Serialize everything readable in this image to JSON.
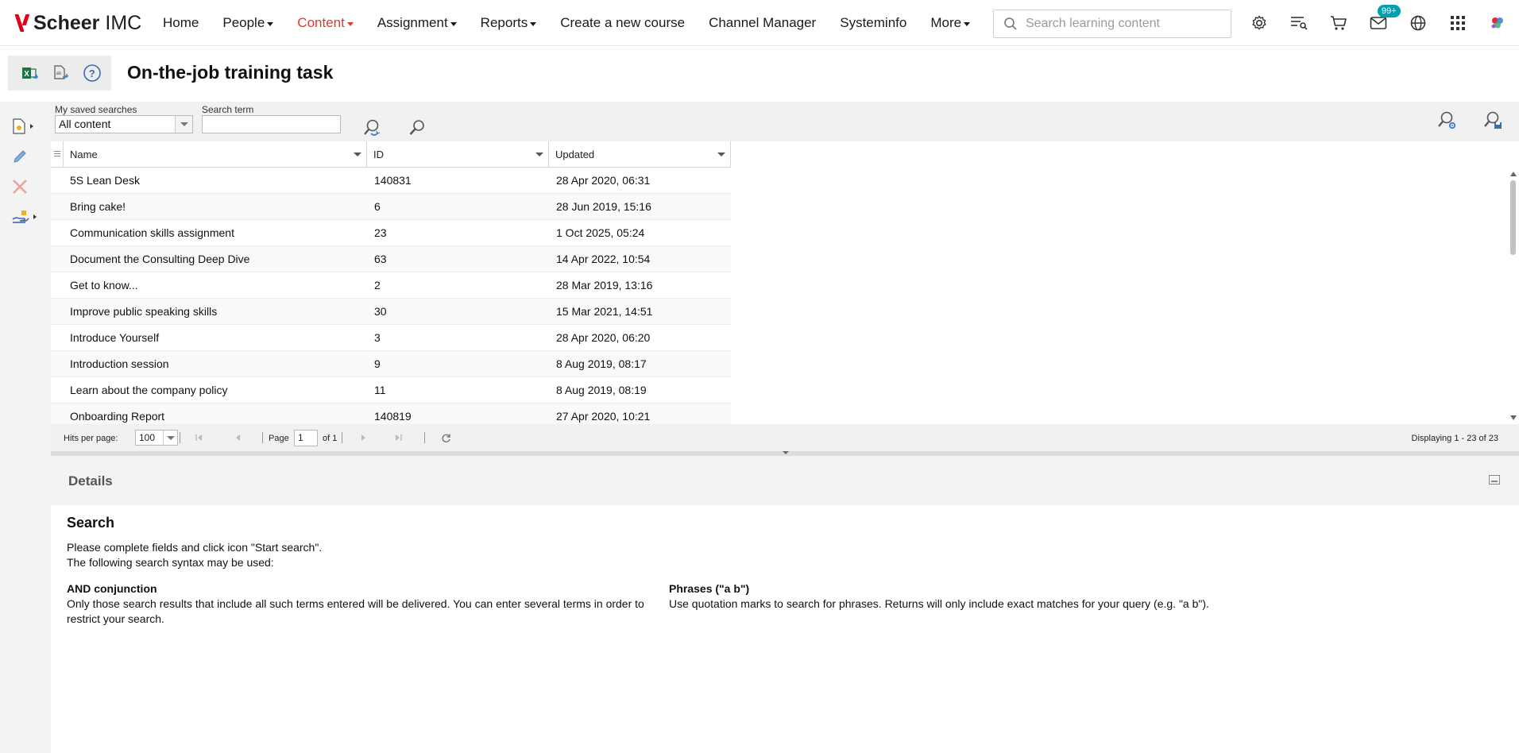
{
  "header": {
    "brand": "Scheer",
    "product": "IMC",
    "nav": [
      {
        "label": "Home",
        "dropdown": false,
        "active": false
      },
      {
        "label": "People",
        "dropdown": true,
        "active": false
      },
      {
        "label": "Content",
        "dropdown": true,
        "active": true
      },
      {
        "label": "Assignment",
        "dropdown": true,
        "active": false
      },
      {
        "label": "Reports",
        "dropdown": true,
        "active": false
      },
      {
        "label": "Create a new course",
        "dropdown": false,
        "active": false
      },
      {
        "label": "Channel Manager",
        "dropdown": false,
        "active": false
      },
      {
        "label": "Systeminfo",
        "dropdown": false,
        "active": false
      },
      {
        "label": "More",
        "dropdown": true,
        "active": false
      }
    ],
    "search_placeholder": "Search learning content",
    "mail_badge": "99+",
    "icons": [
      "gear-icon",
      "playlist-search-icon",
      "cart-icon",
      "mail-icon",
      "globe-icon",
      "apps-grid-icon",
      "colorful-logo-icon"
    ]
  },
  "page": {
    "title": "On-the-job training task"
  },
  "filter": {
    "saved_label": "My saved searches",
    "saved_value": "All content",
    "term_label": "Search term",
    "term_value": ""
  },
  "grid": {
    "columns": [
      "Name",
      "ID",
      "Updated"
    ],
    "rows": [
      {
        "name": "5S Lean Desk",
        "id": "140831",
        "updated": "28 Apr 2020, 06:31"
      },
      {
        "name": "Bring cake!",
        "id": "6",
        "updated": "28 Jun 2019, 15:16"
      },
      {
        "name": "Communication skills assignment",
        "id": "23",
        "updated": "1 Oct 2025, 05:24"
      },
      {
        "name": "Document the Consulting Deep Dive",
        "id": "63",
        "updated": "14 Apr 2022, 10:54"
      },
      {
        "name": "Get to know...",
        "id": "2",
        "updated": "28 Mar 2019, 13:16"
      },
      {
        "name": "Improve public speaking skills",
        "id": "30",
        "updated": "15 Mar 2021, 14:51"
      },
      {
        "name": "Introduce Yourself",
        "id": "3",
        "updated": "28 Apr 2020, 06:20"
      },
      {
        "name": "Introduction session",
        "id": "9",
        "updated": "8 Aug 2019, 08:17"
      },
      {
        "name": "Learn about the company policy",
        "id": "11",
        "updated": "8 Aug 2019, 08:19"
      },
      {
        "name": "Onboarding Report",
        "id": "140819",
        "updated": "27 Apr 2020, 10:21"
      }
    ]
  },
  "pager": {
    "hits_label": "Hits per page:",
    "hits_value": "100",
    "page_label": "Page",
    "page_value": "1",
    "of_label": "of 1",
    "display_text": "Displaying 1 - 23 of 23"
  },
  "details": {
    "title": "Details",
    "search_heading": "Search",
    "intro_line1": "Please complete fields and click icon \"Start search\".",
    "intro_line2": "The following search syntax may be used:",
    "and_title": "AND conjunction",
    "and_text": "Only those search results that include all such terms entered will be delivered. You can enter several terms in order to restrict your search.",
    "phrase_title": "Phrases (\"a b\")",
    "phrase_text": "Use quotation marks to search for phrases. Returns will only include exact matches for your query (e.g. \"a b\")."
  },
  "colors": {
    "accent": "#e0382f",
    "badge": "#00a0b0",
    "brand_red": "#e2001a"
  }
}
